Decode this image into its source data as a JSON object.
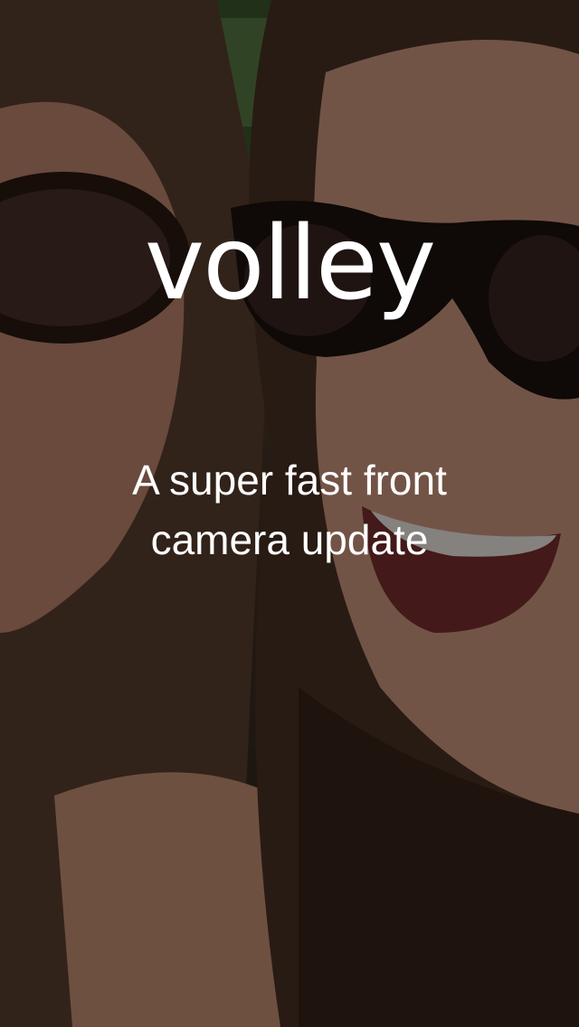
{
  "app": {
    "logo_text": "volley"
  },
  "tagline": {
    "line1": "A super fast front",
    "line2": "camera update"
  },
  "background": {
    "description_icon": "selfie-photo",
    "overlay_color": "#000000"
  }
}
